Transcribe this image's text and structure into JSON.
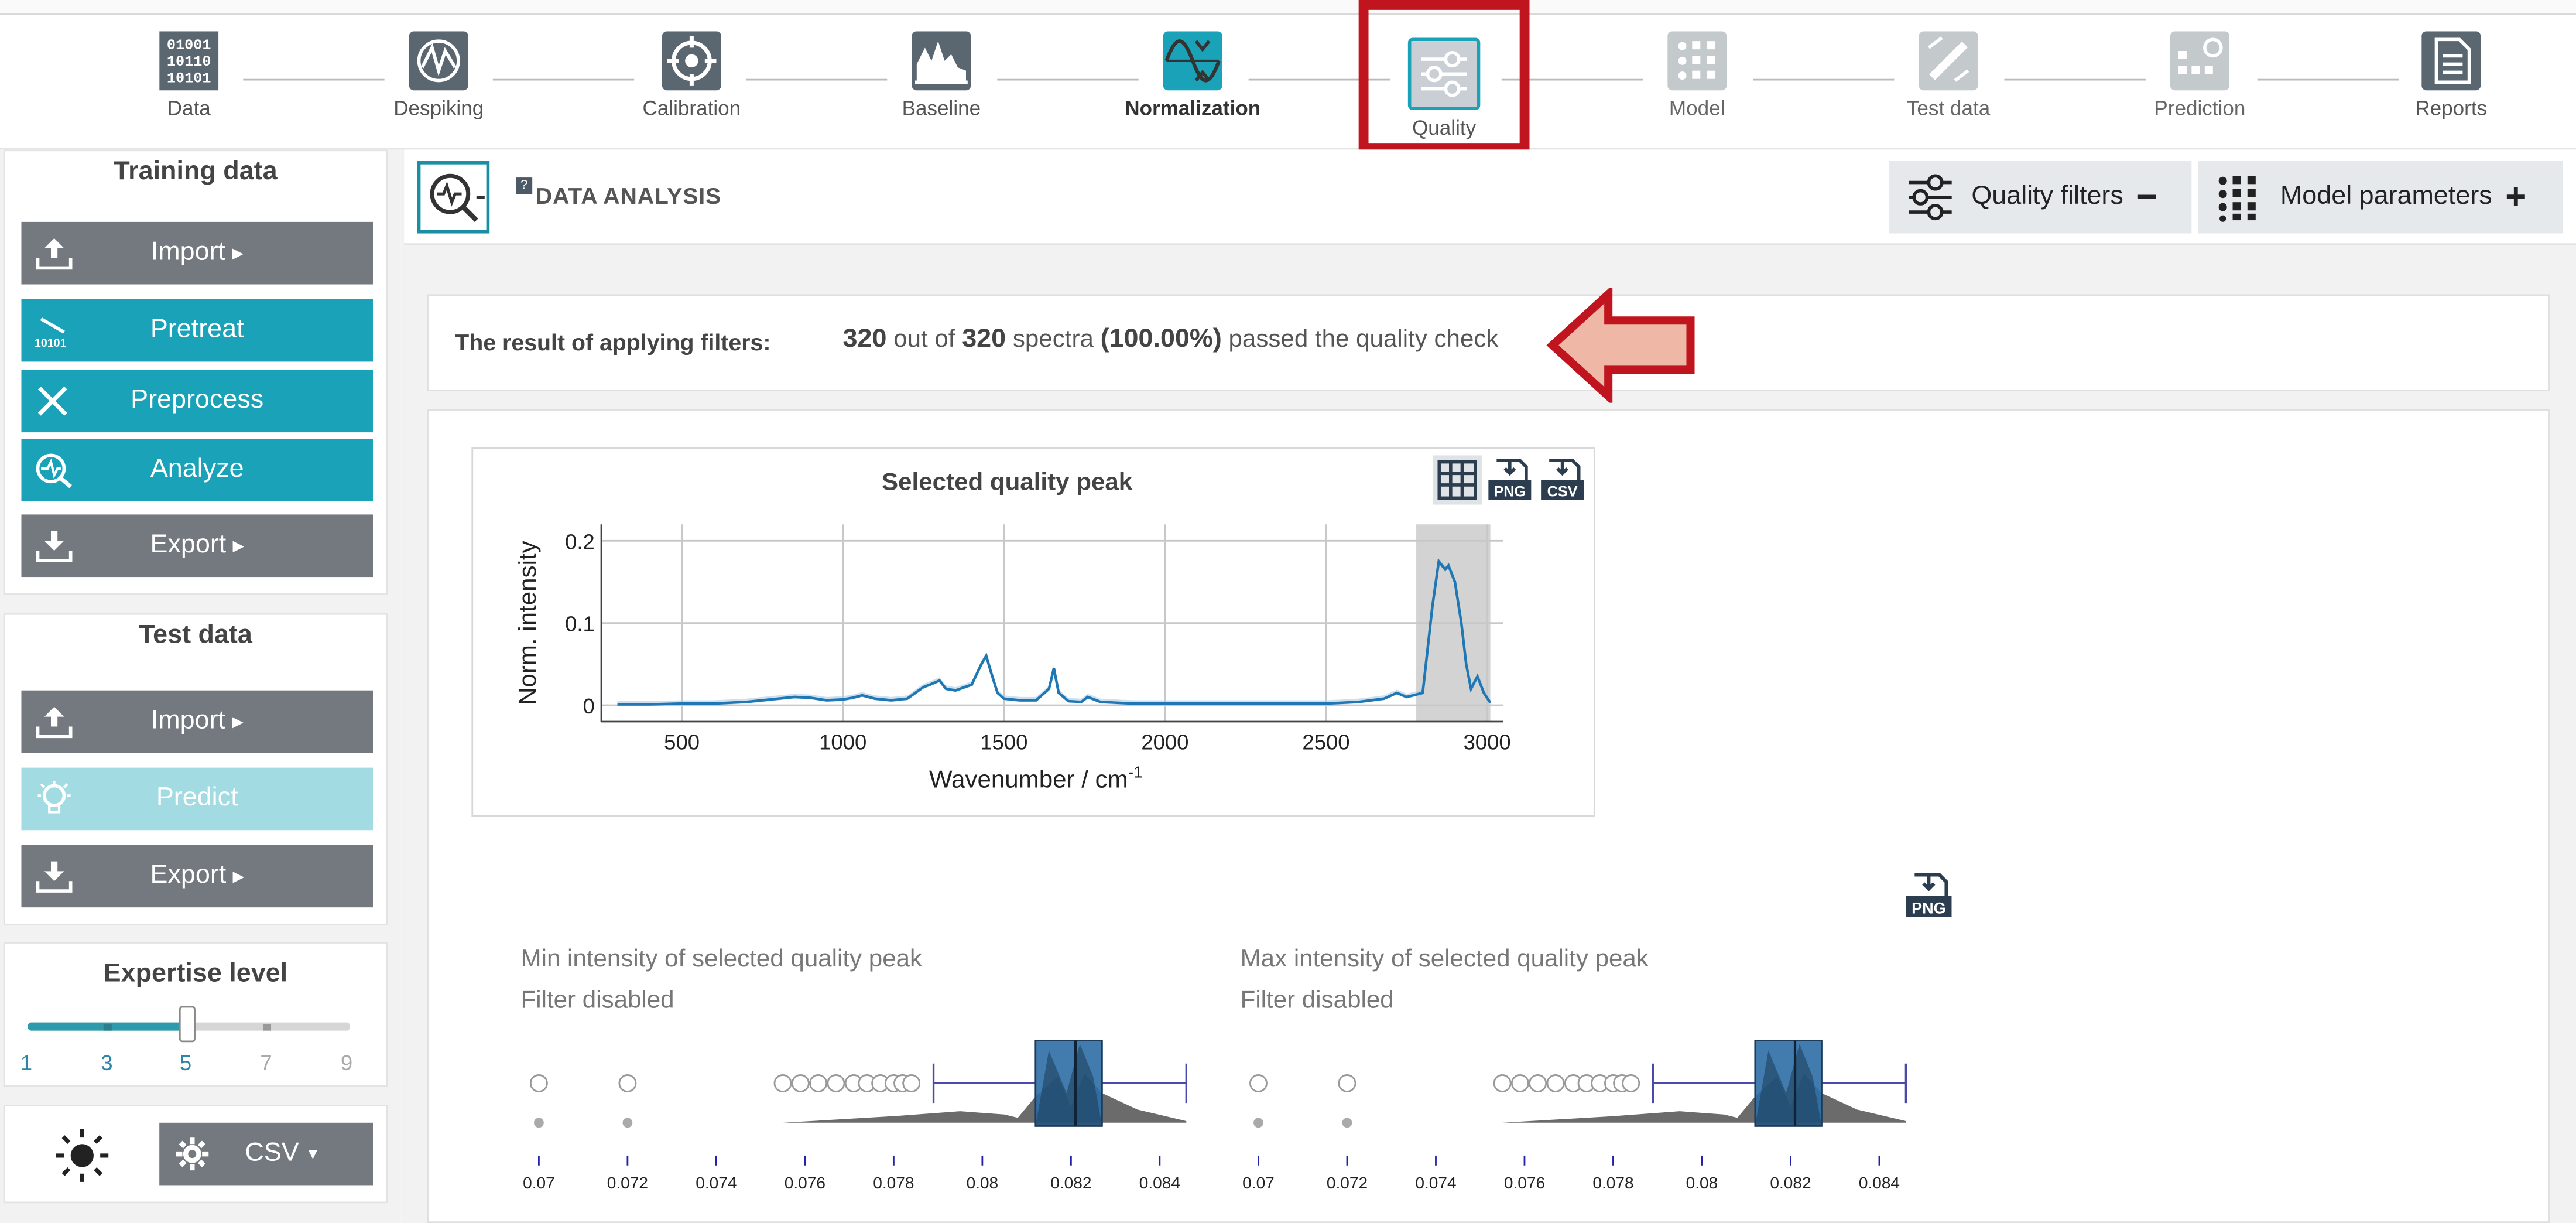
{
  "stepper": {
    "steps": [
      {
        "label": "Data",
        "icon": "binary-data-icon",
        "state": "done"
      },
      {
        "label": "Despiking",
        "icon": "despiking-icon",
        "state": "done"
      },
      {
        "label": "Calibration",
        "icon": "calibration-target-icon",
        "state": "done"
      },
      {
        "label": "Baseline",
        "icon": "baseline-icon",
        "state": "done"
      },
      {
        "label": "Normalization",
        "icon": "normalization-icon",
        "state": "current"
      },
      {
        "label": "Quality",
        "icon": "quality-sliders-icon",
        "state": "active"
      },
      {
        "label": "Model",
        "icon": "model-grid-icon",
        "state": "future"
      },
      {
        "label": "Test data",
        "icon": "test-data-icon",
        "state": "future"
      },
      {
        "label": "Prediction",
        "icon": "prediction-icon",
        "state": "future"
      },
      {
        "label": "Reports",
        "icon": "reports-document-icon",
        "state": "future"
      }
    ]
  },
  "sidebar": {
    "training": {
      "title": "Training data",
      "import": "Import",
      "pretreat": "Pretreat",
      "preprocess": "Preprocess",
      "analyze": "Analyze",
      "export": "Export"
    },
    "test": {
      "title": "Test data",
      "import": "Import",
      "predict": "Predict",
      "export": "Export"
    },
    "expertise": {
      "title": "Expertise level",
      "ticks": [
        "1",
        "3",
        "5",
        "7",
        "9"
      ],
      "value": 5
    },
    "footer": {
      "format": "CSV"
    }
  },
  "header": {
    "title": "DATA ANALYSIS",
    "help": "?",
    "quality_filters": "Quality filters",
    "quality_filters_toggle": "−",
    "model_parameters": "Model parameters",
    "model_parameters_toggle": "+"
  },
  "result": {
    "label": "The result of applying filters:",
    "passed": "320",
    "out_of_text": "out of",
    "total": "320",
    "spectra_text": "spectra",
    "percent": "(100.00%)",
    "tail": "passed the quality check"
  },
  "chart_data": {
    "type": "line",
    "title": "Selected quality peak",
    "xlabel": "Wavenumber / cm",
    "xlabel_sup": "-1",
    "ylabel": "Norm. intensity",
    "xlim": [
      250,
      3050
    ],
    "ylim": [
      -0.02,
      0.22
    ],
    "xticks": [
      "500",
      "1000",
      "1500",
      "2000",
      "2500",
      "3000"
    ],
    "yticks": [
      "0",
      "0.1",
      "0.2"
    ],
    "highlight_range": [
      2780,
      3010
    ],
    "grid": true,
    "series": [
      {
        "color": "#1f77b4",
        "x": [
          300,
          400,
          500,
          600,
          700,
          800,
          850,
          900,
          950,
          1000,
          1030,
          1060,
          1080,
          1100,
          1150,
          1200,
          1250,
          1270,
          1300,
          1320,
          1350,
          1400,
          1430,
          1445,
          1460,
          1480,
          1500,
          1550,
          1600,
          1640,
          1655,
          1670,
          1700,
          1740,
          1760,
          1800,
          1900,
          2000,
          2100,
          2200,
          2300,
          2400,
          2500,
          2600,
          2680,
          2720,
          2750,
          2800,
          2830,
          2850,
          2870,
          2880,
          2900,
          2920,
          2935,
          2950,
          2970,
          2990,
          3010
        ],
        "y": [
          0.001,
          0.001,
          0.002,
          0.002,
          0.004,
          0.008,
          0.01,
          0.009,
          0.006,
          0.007,
          0.009,
          0.012,
          0.01,
          0.008,
          0.006,
          0.008,
          0.022,
          0.025,
          0.03,
          0.02,
          0.018,
          0.025,
          0.05,
          0.06,
          0.04,
          0.015,
          0.008,
          0.006,
          0.006,
          0.02,
          0.045,
          0.015,
          0.005,
          0.004,
          0.01,
          0.004,
          0.002,
          0.002,
          0.002,
          0.002,
          0.002,
          0.002,
          0.002,
          0.004,
          0.008,
          0.015,
          0.01,
          0.015,
          0.12,
          0.175,
          0.165,
          0.17,
          0.15,
          0.1,
          0.05,
          0.02,
          0.035,
          0.015,
          0.003
        ]
      }
    ]
  },
  "distribution": {
    "png_icon": "png-download-icon",
    "axis_ticks": [
      "0.07",
      "0.072",
      "0.074",
      "0.076",
      "0.078",
      "0.08",
      "0.082",
      "0.084"
    ],
    "left": {
      "title": "Min intensity of selected quality peak",
      "status": "Filter disabled",
      "outliers": [
        0.07,
        0.072,
        0.0755,
        0.0759,
        0.0763,
        0.0767,
        0.0771,
        0.0774,
        0.0777,
        0.078,
        0.0782,
        0.0784
      ],
      "whisker_low": 0.0789,
      "q1": 0.0812,
      "median": 0.0821,
      "q3": 0.0827,
      "whisker_high": 0.0846
    },
    "right": {
      "title": "Max intensity of selected quality peak",
      "status": "Filter disabled",
      "outliers": [
        0.07,
        0.072,
        0.0755,
        0.0759,
        0.0763,
        0.0767,
        0.0771,
        0.0774,
        0.0777,
        0.078,
        0.0782,
        0.0784
      ],
      "whisker_low": 0.0789,
      "q1": 0.0812,
      "median": 0.0821,
      "q3": 0.0827,
      "whisker_high": 0.0846
    }
  }
}
